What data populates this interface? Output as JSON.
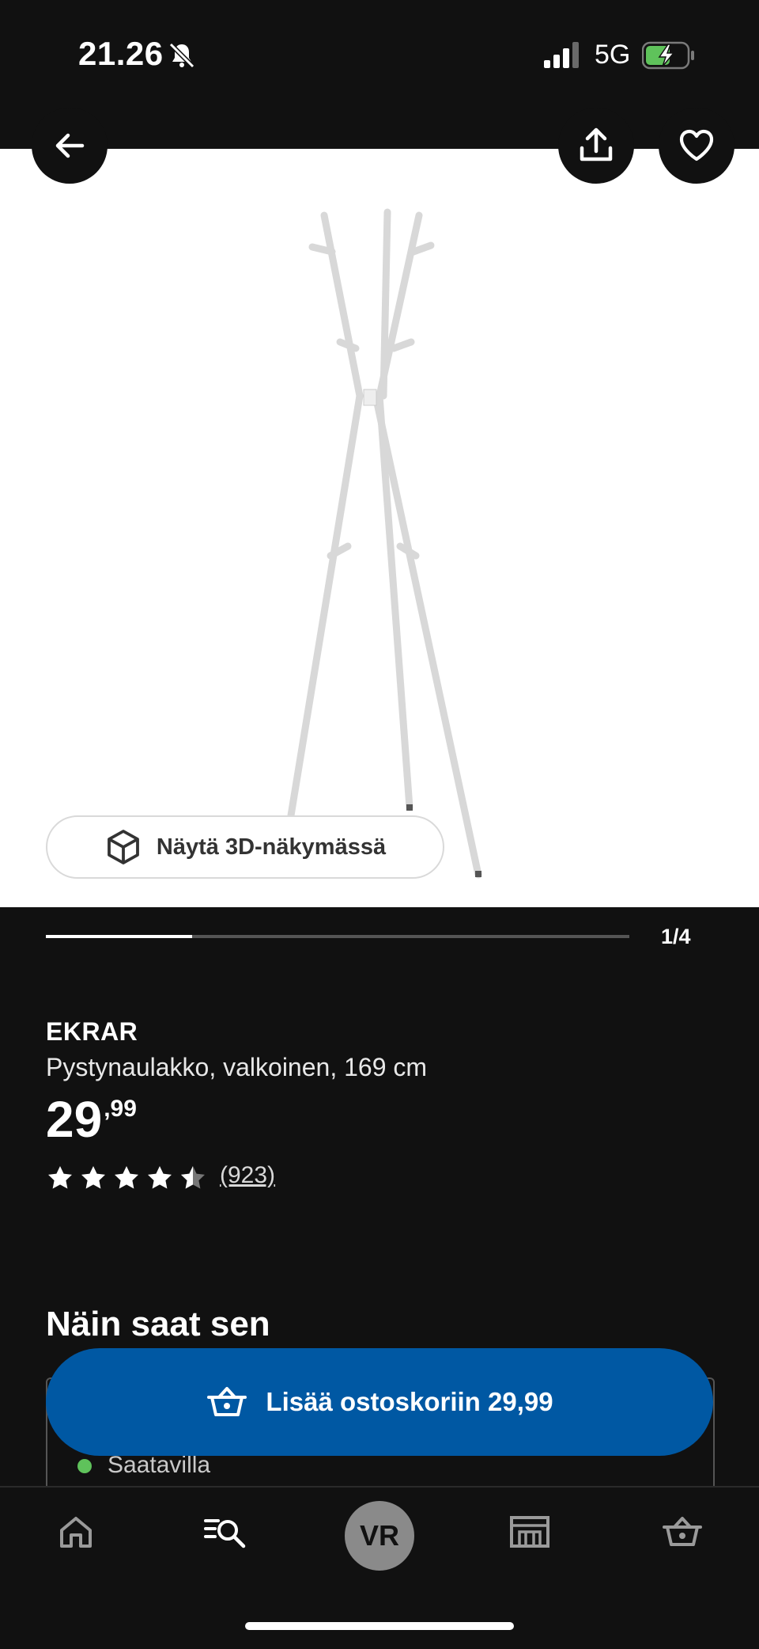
{
  "status": {
    "time": "21.26",
    "network": "5G"
  },
  "image": {
    "view_3d_label": "Näytä 3D-näkymässä",
    "counter": "1/4",
    "progress": 0.25
  },
  "product": {
    "brand": "EKRAR",
    "description": "Pystynaulakko, valkoinen, 169 cm",
    "price_main": "29",
    "price_cents": ",99",
    "rating": 4.5,
    "reviews": "(923)"
  },
  "delivery": {
    "title": "Näin saat sen",
    "availability": "Saatavilla"
  },
  "cart": {
    "label": "Lisää ostoskoriin 29,99"
  },
  "nav": {
    "avatar_initials": "VR"
  },
  "colors": {
    "accent_blue": "#0058a3",
    "available_green": "#5fc25b",
    "background": "#111111"
  }
}
